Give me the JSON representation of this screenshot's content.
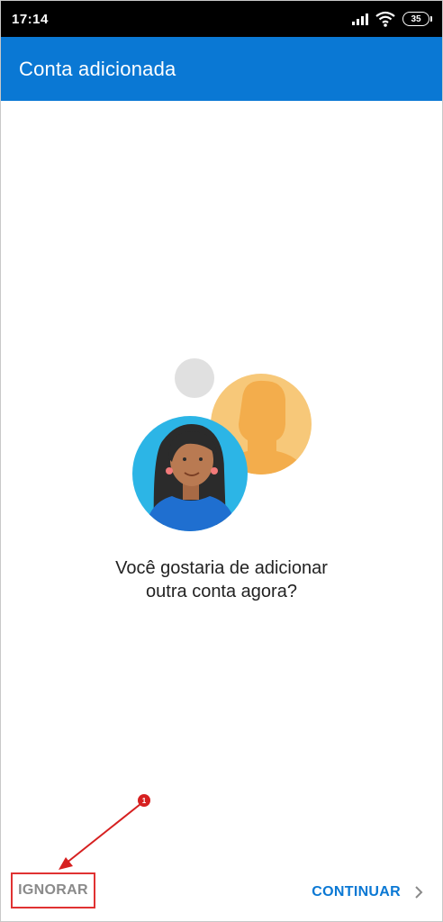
{
  "status_bar": {
    "time": "17:14",
    "battery": "35",
    "icons": [
      "signal-icon",
      "wifi-icon",
      "battery-icon"
    ]
  },
  "app_bar": {
    "title": "Conta adicionada",
    "color": "#0a78d4"
  },
  "illustration": {
    "icon": "accounts-illustration-icon",
    "colors": {
      "person_bg": "#29b6e8",
      "silhouette_bg": "#f7c879",
      "grey_circle": "#e0e0e0"
    }
  },
  "prompt": {
    "line1": "Você gostaria de adicionar",
    "line2": "outra conta agora?"
  },
  "actions": {
    "ignore_label": "IGNORAR",
    "continue_label": "CONTINUAR",
    "continue_color": "#0a78d4"
  },
  "annotation": {
    "marker_number": "1",
    "color": "#d62020"
  }
}
